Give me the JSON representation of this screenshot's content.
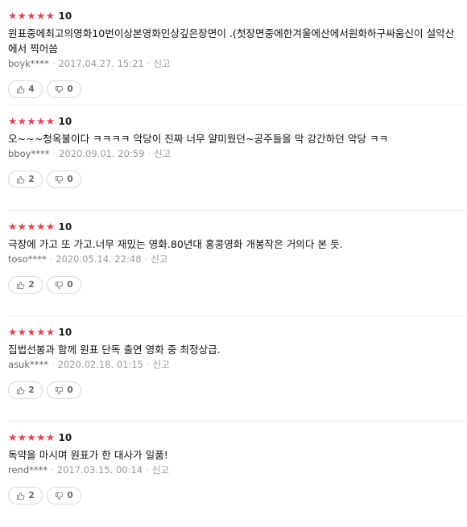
{
  "reviews": [
    {
      "stars": "★★★★★",
      "score": "10",
      "text": "원표중에최고의영화10번이상본영화인상깊은장면이 .(첫장면중에한겨울에산에서원화하구싸움신이 설악산에서 찍어씀",
      "user": "boyk****",
      "date": "2017.04.27. 15:21",
      "report": "신고",
      "likes": "4",
      "dislikes": "0"
    },
    {
      "stars": "★★★★★",
      "score": "10",
      "text": "오~~~청옥불이다 ㅋㅋㅋㅋ 악당이 진짜 너무 얄미웠던~공주들을 막 강간하던 악당 ㅋㅋ",
      "user": "bboy****",
      "date": "2020.09.01. 20:59",
      "report": "신고",
      "likes": "2",
      "dislikes": "0"
    },
    {
      "stars": "★★★★★",
      "score": "10",
      "text": "극장에 가고 또 가고.너무 재밌는 영화.80년대 홍콩영화 개봉작은 거의다 본 듯.",
      "user": "toso****",
      "date": "2020.05.14. 22:48",
      "report": "신고",
      "likes": "2",
      "dislikes": "0"
    },
    {
      "stars": "★★★★★",
      "score": "10",
      "text": "집법선봉과 함께 원표 단독 출연 영화 중 최정상급.",
      "user": "asuk****",
      "date": "2020.02.18. 01:15",
      "report": "신고",
      "likes": "2",
      "dislikes": "0"
    },
    {
      "stars": "★★★★★",
      "score": "10",
      "text": "독약을 마시며 원표가 한 대사가 일품!",
      "user": "rend****",
      "date": "2017.03.15. 00:14",
      "report": "신고",
      "likes": "2",
      "dislikes": "0"
    }
  ],
  "colors": {
    "star": "#ee3f4d",
    "meta": "#999999",
    "border": "#d8d8d8"
  },
  "icons": {
    "like": "thumbs-up-icon",
    "dislike": "thumbs-down-icon"
  }
}
